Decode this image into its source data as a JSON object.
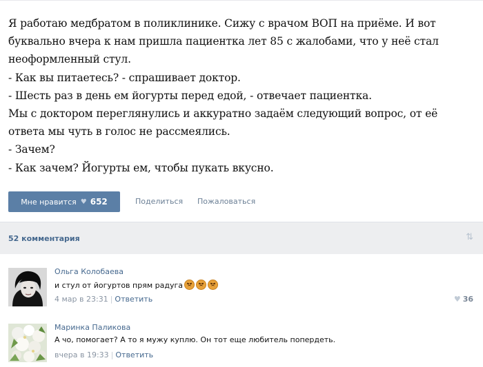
{
  "post": {
    "lines": [
      "Я работаю медбратом в поликлинике. Сижу с врачом ВОП на приёме. И вот",
      "буквально вчера к нам пришла пациентка лет 85 с жалобами, что у неё стал",
      "неоформленный стул.",
      "- Как вы питаетесь? - спрашивает доктор.",
      "- Шесть раз в день ем йогурты перед едой, - отвечает пациентка.",
      "Мы с доктором переглянулись и аккуратно задаём следующий вопрос, от её",
      "ответа мы чуть в голос не рассмеялись.",
      "- Зачем?",
      "- Как зачем? Йогурты ем, чтобы пукать вкусно."
    ],
    "like_label": "Мне нравится",
    "like_count": "652",
    "share_label": "Поделиться",
    "report_label": "Пожаловаться"
  },
  "comments_header": {
    "count_label": "52 комментария",
    "sort_icon": "sort-arrows-icon"
  },
  "comments": [
    {
      "author": "Ольга Колобаева",
      "text": "и стул от йогуртов прям радуга",
      "emoji_count": 3,
      "date": "4 мар в 23:31",
      "reply_label": "Ответить",
      "likes": "36"
    },
    {
      "author": "Маринка Паликова",
      "text": "А чо, помогает? А то я мужу куплю. Он тот еще любитель попердеть.",
      "date": "вчера в 19:33",
      "reply_label": "Ответить"
    }
  ],
  "colors": {
    "link": "#45688e",
    "like_button": "#5b7fa6",
    "header_bg": "#edeef0"
  }
}
